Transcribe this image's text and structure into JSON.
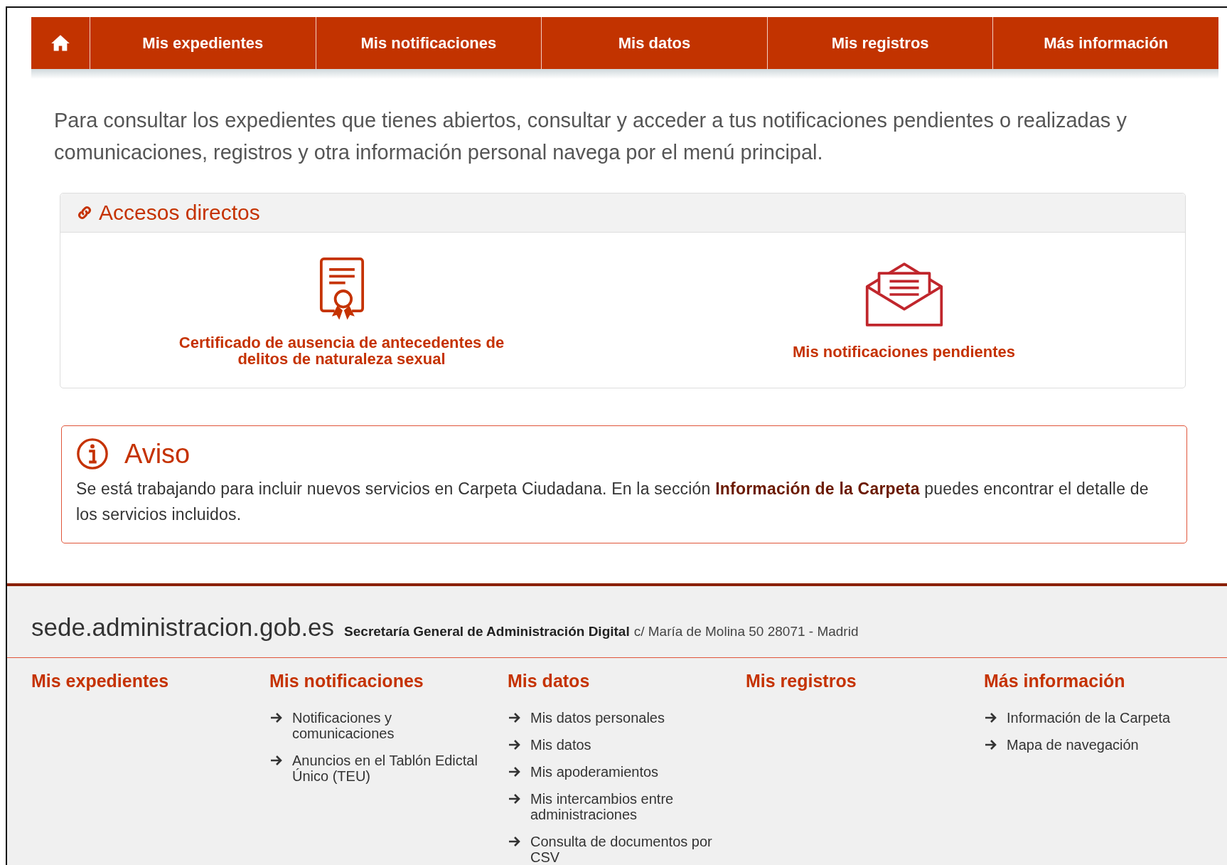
{
  "nav": {
    "items": [
      {
        "kind": "home"
      },
      {
        "kind": "text",
        "label": "Mis expedientes"
      },
      {
        "kind": "text",
        "label": "Mis notificaciones"
      },
      {
        "kind": "text",
        "label": "Mis datos"
      },
      {
        "kind": "text",
        "label": "Mis registros"
      },
      {
        "kind": "text",
        "label": "Más información"
      }
    ]
  },
  "intro": "Para consultar los expedientes que tienes abiertos, consultar y acceder a tus notificaciones pendientes o realizadas y comunicaciones, registros y otra información personal navega por el menú principal.",
  "shortcuts": {
    "title": "Accesos directos",
    "items": [
      {
        "kind": "certificate",
        "label": "Certificado de ausencia de antecedentes de delitos de naturaleza sexual"
      },
      {
        "kind": "envelope",
        "label": "Mis notificaciones pendientes"
      }
    ]
  },
  "notice": {
    "title": "Aviso",
    "text": "Se está trabajando para incluir nuevos servicios en Carpeta Ciudadana. En la sección **Información de la Carpeta** puedes encontrar el detalle de los servicios incluidos."
  },
  "footer": {
    "site": "sede.administracion.gob.es",
    "org": "Secretaría General de Administración Digital",
    "address": "c/ María de Molina 50 28071 - Madrid",
    "columns": [
      {
        "heading": "Mis expedientes"
      },
      {
        "heading": "Mis notificaciones",
        "links": [
          "Notificaciones y comunicaciones",
          "Anuncios en el Tablón Edictal Único (TEU)"
        ]
      },
      {
        "heading": "Mis datos",
        "links": [
          "Mis datos personales",
          "Mis datos",
          "Mis apoderamientos",
          "Mis intercambios entre administraciones",
          "Consulta de documentos por CSV"
        ]
      },
      {
        "heading": "Mis registros"
      },
      {
        "heading": "Más información",
        "links": [
          "Información de la Carpeta",
          "Mapa de navegación"
        ]
      }
    ]
  }
}
